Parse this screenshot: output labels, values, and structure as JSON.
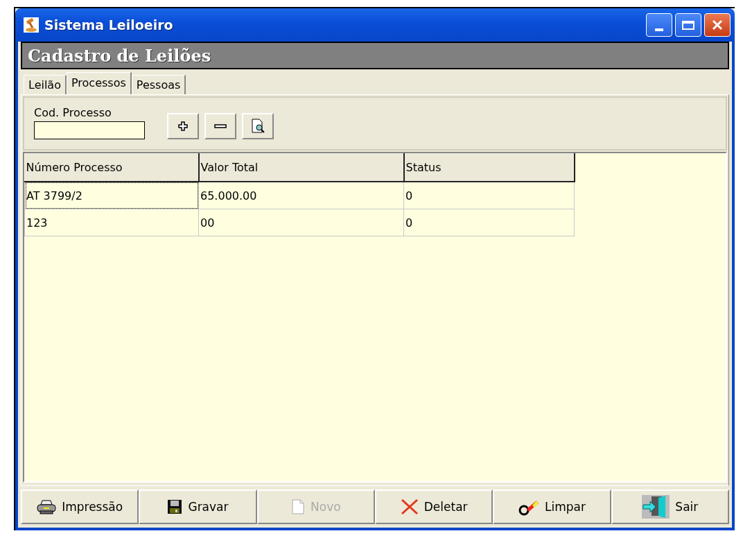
{
  "window": {
    "title": "Sistema Leiloeiro"
  },
  "header": "Cadastro de Leilões",
  "tabs": [
    {
      "label": "Leilão",
      "selected": false
    },
    {
      "label": "Processos",
      "selected": true
    },
    {
      "label": "Pessoas",
      "selected": false
    }
  ],
  "filter": {
    "label": "Cod. Processo",
    "tools": [
      {
        "kind": "add"
      },
      {
        "kind": "remove"
      },
      {
        "kind": "preview"
      }
    ]
  },
  "table": {
    "columns": [
      "Número Processo",
      "Valor Total",
      "Status"
    ],
    "rows": [
      {
        "cells": [
          "AT 3799/2",
          "65.000.00",
          "0"
        ],
        "focused": true
      },
      {
        "cells": [
          "123",
          "00",
          "0"
        ],
        "focused": false
      }
    ]
  },
  "buttons": [
    {
      "label": "Impressão",
      "kind": "print",
      "disabled": false
    },
    {
      "label": "Gravar",
      "kind": "save",
      "disabled": false
    },
    {
      "label": "Novo",
      "kind": "new",
      "disabled": true
    },
    {
      "label": "Deletar",
      "kind": "delete",
      "disabled": false
    },
    {
      "label": "Limpar",
      "kind": "clear",
      "disabled": false
    },
    {
      "label": "Sair",
      "kind": "exit",
      "disabled": false
    }
  ]
}
